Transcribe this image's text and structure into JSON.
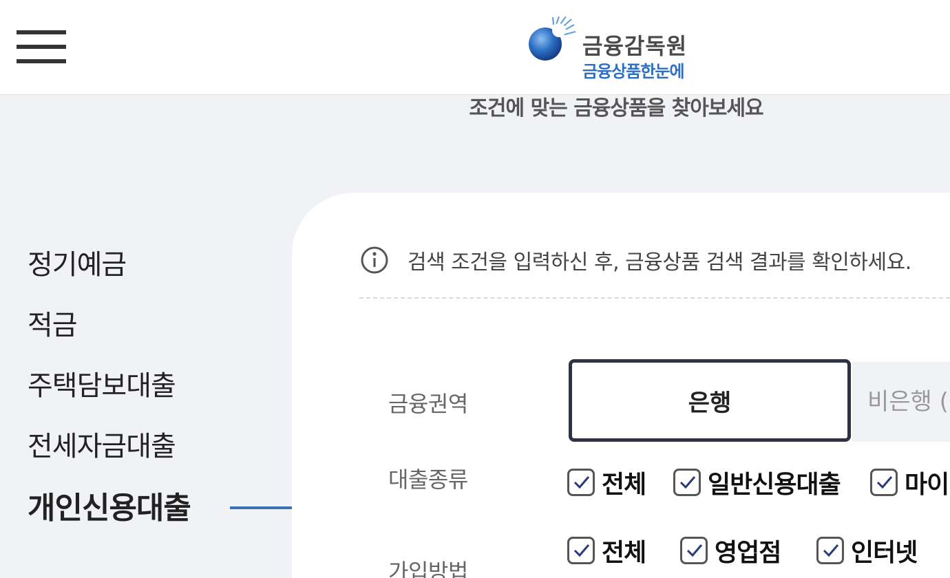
{
  "header": {
    "menu_icon": "hamburger-menu-icon",
    "logo_icon": "fss-globe-logo",
    "org_name": "금융감독원",
    "service_name": "금융상품한눈에"
  },
  "subtitle": "조건에 맞는 금융상품을 찾아보세요",
  "sidebar": {
    "items": [
      {
        "label": "정기예금",
        "active": false
      },
      {
        "label": "적금",
        "active": false
      },
      {
        "label": "주택담보대출",
        "active": false
      },
      {
        "label": "전세자금대출",
        "active": false
      },
      {
        "label": "개인신용대출",
        "active": true
      }
    ],
    "active_indicator_icon": "arrow-right-icon"
  },
  "search": {
    "notice_icon": "info-icon",
    "notice": "검색 조건을 입력하신 후, 금융상품 검색 결과를 확인하세요.",
    "sector": {
      "label": "금융권역",
      "options": [
        {
          "label": "은행",
          "selected": true
        },
        {
          "label": "비은행 (",
          "selected": false
        }
      ]
    },
    "loan_type": {
      "label": "대출종류",
      "options": [
        {
          "label": "전체",
          "checked": true
        },
        {
          "label": "일반신용대출",
          "checked": true
        },
        {
          "label": "마이",
          "checked": true
        }
      ]
    },
    "join_method": {
      "label": "가입방법",
      "options": [
        {
          "label": "전체",
          "checked": true
        },
        {
          "label": "영업점",
          "checked": true
        },
        {
          "label": "인터넷",
          "checked": true
        }
      ]
    }
  },
  "colors": {
    "page_bg": "#f1f2f6",
    "brand_blue": "#2e6fc2",
    "arrow_blue": "#3a72b8",
    "check_navy": "#2b3a7a",
    "selected_border": "#2f3340"
  }
}
